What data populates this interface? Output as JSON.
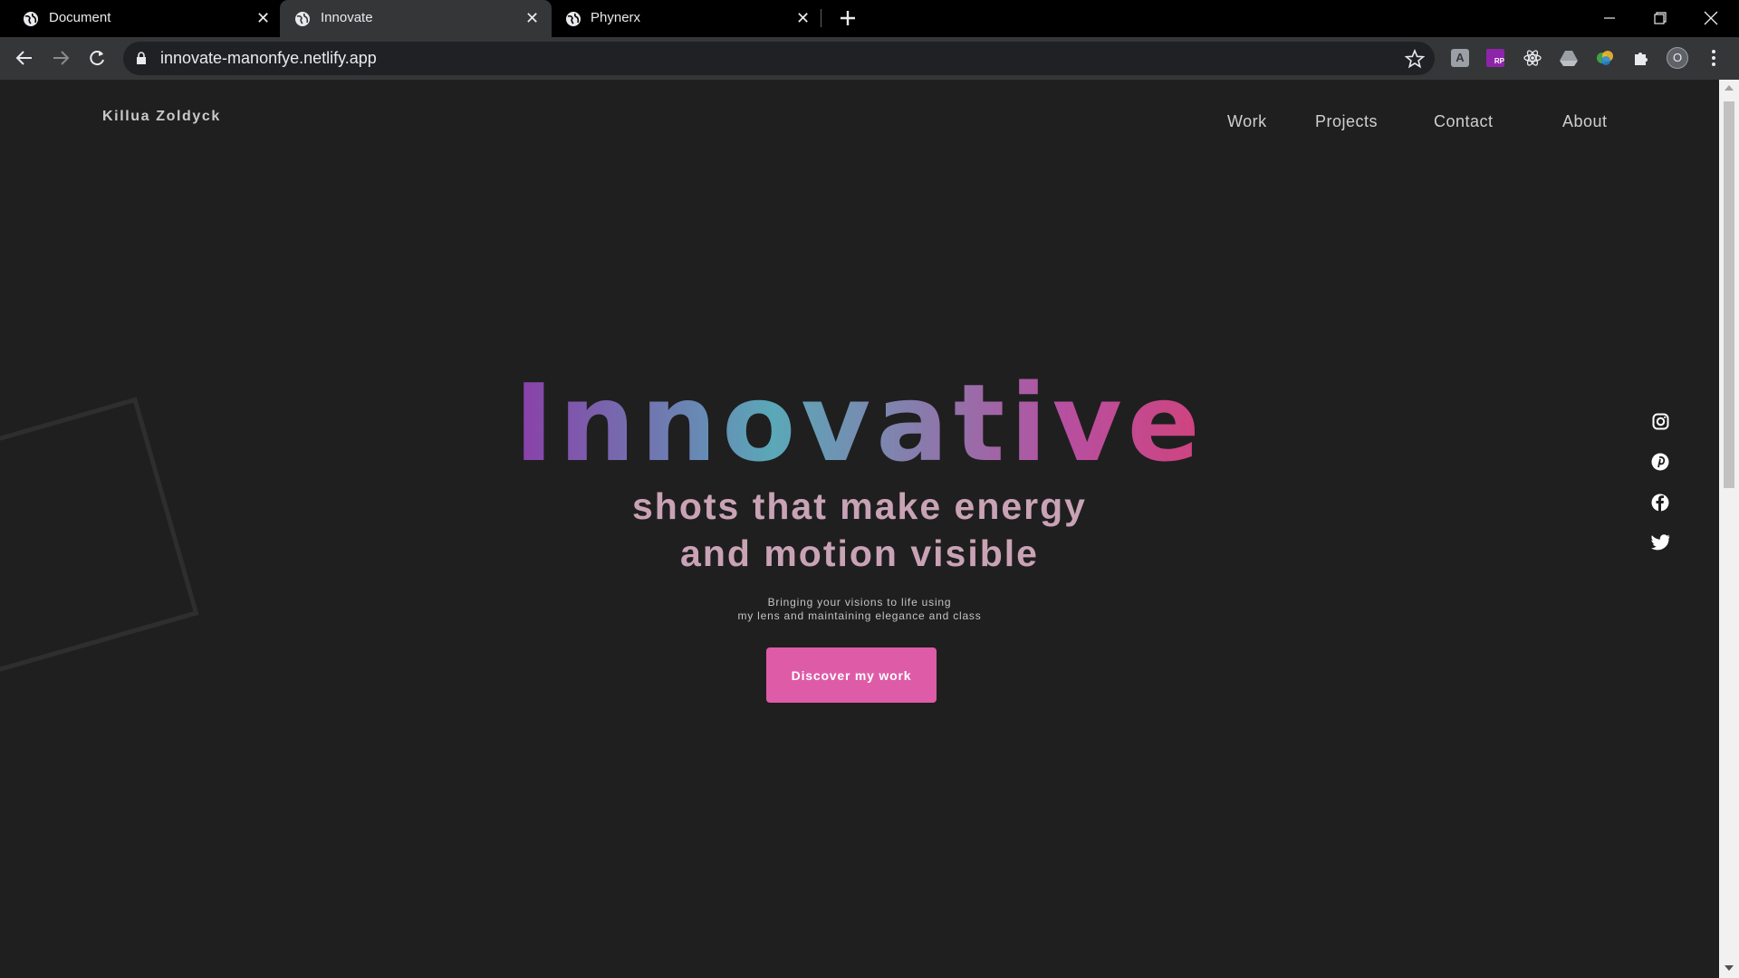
{
  "browser": {
    "tabs": [
      {
        "title": "Document",
        "active": false
      },
      {
        "title": "Innovate",
        "active": true
      },
      {
        "title": "Phynerx",
        "active": false
      }
    ],
    "url": "innovate-manonfye.netlify.app",
    "profile_initial": "O",
    "extension_icons": [
      "grammar-extension-icon",
      "rp-extension-icon",
      "react-devtools-icon",
      "drive-icon",
      "color-extension-icon",
      "puzzle-icon"
    ]
  },
  "site": {
    "brand": "Killua Zoldyck",
    "nav": [
      "Work",
      "Projects",
      "Contact",
      "About"
    ],
    "hero": {
      "title": "Innovative",
      "subtitle_line1": "shots that make energy",
      "subtitle_line2": "and motion visible",
      "desc_line1": "Bringing your visions to life using",
      "desc_line2": "my lens and maintaining elegance and class",
      "cta": "Discover my work"
    },
    "social_icons": [
      "instagram-icon",
      "pinterest-icon",
      "facebook-icon",
      "twitter-icon"
    ],
    "colors": {
      "background": "#1f1f1f",
      "cta": "#de5ba8",
      "subtitle": "#c9a3b5"
    }
  }
}
